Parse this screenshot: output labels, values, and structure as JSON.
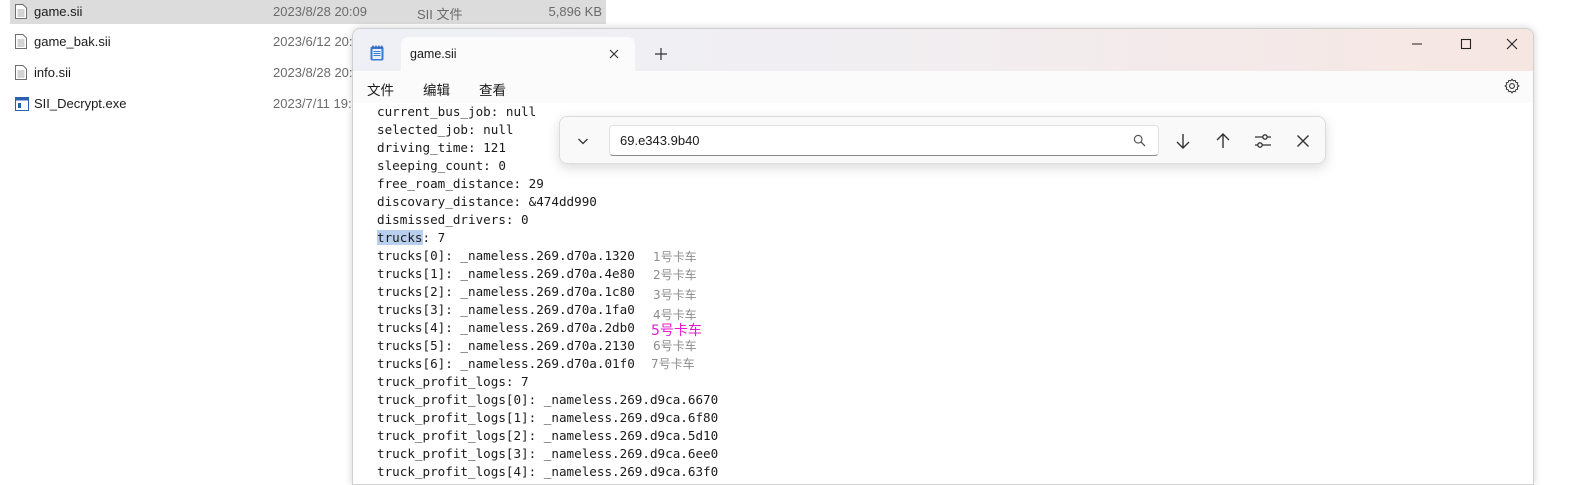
{
  "explorer": {
    "files": [
      {
        "name": "game.sii",
        "date": "2023/8/28 20:09",
        "type": "SII 文件",
        "size": "5,896 KB",
        "icon": "text-file-icon"
      },
      {
        "name": "game_bak.sii",
        "date": "2023/6/12 20:",
        "type": "",
        "size": "",
        "icon": "text-file-icon"
      },
      {
        "name": "info.sii",
        "date": "2023/8/28 20:",
        "type": "",
        "size": "",
        "icon": "text-file-icon"
      },
      {
        "name": "SII_Decrypt.exe",
        "date": "2023/7/11 19:",
        "type": "",
        "size": "",
        "icon": "exe-file-icon"
      }
    ]
  },
  "notepad": {
    "tab_title": "game.sii",
    "menu": [
      "文件",
      "编辑",
      "查看"
    ],
    "find": {
      "value": "69.e343.9b40"
    },
    "lines": [
      "current_bus_job: null",
      "selected_job: null",
      "driving_time: 121",
      "sleeping_count: 0",
      "free_roam_distance: 29",
      "discovary_distance: &474dd990",
      "dismissed_drivers: 0",
      ": 7",
      "trucks[0]: _nameless.269.d70a.1320",
      "trucks[1]: _nameless.269.d70a.4e80",
      "trucks[2]: _nameless.269.d70a.1c80",
      "trucks[3]: _nameless.269.d70a.1fa0",
      "trucks[4]: _nameless.269.d70a.2db0",
      "trucks[5]: _nameless.269.d70a.2130",
      "trucks[6]: _nameless.269.d70a.01f0",
      "truck_profit_logs: 7",
      "truck_profit_logs[0]: _nameless.269.d9ca.6670",
      "truck_profit_logs[1]: _nameless.269.d9ca.6f80",
      "truck_profit_logs[2]: _nameless.269.d9ca.5d10",
      "truck_profit_logs[3]: _nameless.269.d9ca.6ee0",
      "truck_profit_logs[4]: _nameless.269.d9ca.63f0"
    ],
    "highlighted_word": "trucks",
    "annotations": [
      "1号卡车",
      "2号卡车",
      "3号卡车",
      "4号卡车",
      "5号卡车",
      "6号卡车",
      "7号卡车"
    ]
  },
  "colors": {
    "selection_row": "#dcdcdc",
    "search_highlight": "#b8d0ee",
    "annotation_grey": "#8c8c8c",
    "annotation_pink": "#e81ad1"
  }
}
